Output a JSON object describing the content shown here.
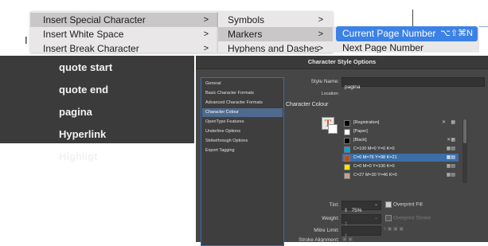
{
  "menu": {
    "col1": [
      {
        "label": "Insert Special Character",
        "selected": true
      },
      {
        "label": "Insert White Space",
        "selected": false
      },
      {
        "label": "Insert Break Character",
        "selected": false
      }
    ],
    "col1_edge_letter": "I",
    "col2": [
      {
        "label": "Symbols",
        "selected": false
      },
      {
        "label": "Markers",
        "selected": true
      },
      {
        "label": "Hyphens and Dashes",
        "selected": false
      }
    ],
    "col3": {
      "highlighted": "Current Page Number",
      "shortcut": "⌥⇧⌘N",
      "next": "Next Page Number"
    }
  },
  "style_list": [
    "quote start",
    "quote end",
    "pagina",
    "Hyperlink",
    "Highligt"
  ],
  "dialog": {
    "title": "Character Style Options",
    "categories": [
      {
        "label": "General",
        "selected": false
      },
      {
        "label": "Basic Character Formats",
        "selected": false
      },
      {
        "label": "Advanced Character Formats",
        "selected": false
      },
      {
        "label": "Character Colour",
        "selected": true
      },
      {
        "label": "OpenType Features",
        "selected": false
      },
      {
        "label": "Underline Options",
        "selected": false
      },
      {
        "label": "Strikethrough Options",
        "selected": false
      },
      {
        "label": "Export Tagging",
        "selected": false
      }
    ],
    "style_name_label": "Style Name:",
    "style_name_value": "pagina",
    "location_label": "Location:",
    "section_heading": "Character Colour",
    "swatches": [
      {
        "name": "[Registration]",
        "color": "#000000",
        "selected": false
      },
      {
        "name": "[Paper]",
        "color": "#ffffff",
        "selected": false
      },
      {
        "name": "[Black]",
        "color": "#000000",
        "selected": false
      },
      {
        "name": "C=100 M=0 Y=0 K=0",
        "color": "#00a3e0",
        "selected": false
      },
      {
        "name": "C=0 M=76 Y=98 K=21",
        "color": "#c24a18",
        "selected": true
      },
      {
        "name": "C=0 M=0 Y=100 K=0",
        "color": "#ffe600",
        "selected": false
      },
      {
        "name": "C=27 M=30 Y=46 K=0",
        "color": "#bfa88a",
        "selected": false
      }
    ],
    "tint_label": "Tint:",
    "tint_value": "75%",
    "overprint_fill": "Overprint Fill",
    "weight_label": "Weight:",
    "overprint_stroke": "Overprint Stroke",
    "mitre_label": "Mitre Limit:",
    "stroke_alignment_label": "Stroke Alignment:"
  },
  "colors": {
    "menu_bg": "#e9e7e7",
    "menu_highlight": "#3c82e6",
    "panel_dark": "#3b3b3b",
    "dialog_bg": "#464646",
    "category_selected": "#506a8f"
  }
}
